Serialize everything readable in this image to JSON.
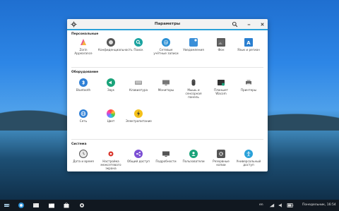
{
  "window": {
    "title": "Параметры"
  },
  "sections": {
    "personal": "Персональные",
    "hardware": "Оборудование",
    "system": "Система"
  },
  "personal_items": [
    {
      "label": "Zorin Appearance",
      "icon": "zorin-appearance-icon"
    },
    {
      "label": "Конфиденциальность",
      "icon": "privacy-icon"
    },
    {
      "label": "Поиск",
      "icon": "search-icon"
    },
    {
      "label": "Сетевые учётные записи",
      "icon": "online-accounts-icon"
    },
    {
      "label": "Уведомления",
      "icon": "notifications-icon"
    },
    {
      "label": "Фон",
      "icon": "background-icon"
    },
    {
      "label": "Язык и регион",
      "icon": "language-icon"
    }
  ],
  "hardware_items": [
    {
      "label": "Bluetooth",
      "icon": "bluetooth-icon"
    },
    {
      "label": "Звук",
      "icon": "sound-icon"
    },
    {
      "label": "Клавиатура",
      "icon": "keyboard-icon"
    },
    {
      "label": "Мониторы",
      "icon": "monitor-icon"
    },
    {
      "label": "Мышь и сенсорная панель",
      "icon": "mouse-icon"
    },
    {
      "label": "Планшет Wacom",
      "icon": "tablet-icon"
    },
    {
      "label": "Принтеры",
      "icon": "printer-icon"
    },
    {
      "label": "Сеть",
      "icon": "network-icon"
    },
    {
      "label": "Цвет",
      "icon": "color-icon"
    },
    {
      "label": "Электропитание",
      "icon": "power-icon"
    }
  ],
  "system_items": [
    {
      "label": "Дата и время",
      "icon": "clock-icon"
    },
    {
      "label": "Настройка межсетевого экрана",
      "icon": "firewall-icon"
    },
    {
      "label": "Общий доступ",
      "icon": "sharing-icon"
    },
    {
      "label": "Подробности",
      "icon": "details-icon"
    },
    {
      "label": "Пользователи",
      "icon": "users-icon"
    },
    {
      "label": "Резервные копии",
      "icon": "backup-icon"
    },
    {
      "label": "Универсальный доступ",
      "icon": "accessibility-icon"
    }
  ],
  "taskbar": {
    "keyboard_layout": "en",
    "clock": "Понедельник, 16:54"
  }
}
